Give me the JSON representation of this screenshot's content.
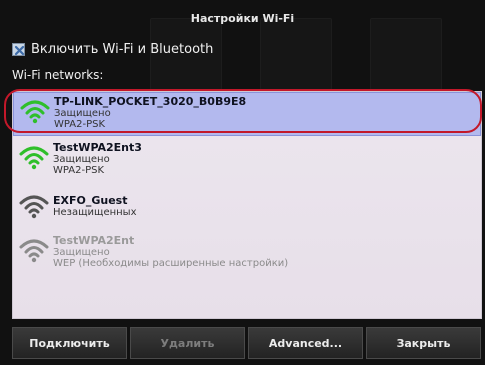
{
  "dialog": {
    "title": "Настройки Wi-Fi"
  },
  "toggle": {
    "label": "Включить Wi-Fi и Bluetooth",
    "checked": false
  },
  "networks_heading": "Wi-Fi networks:",
  "networks": [
    {
      "name": "TP-LINK_POCKET_3020_B0B9E8",
      "status": "Защищено",
      "security": "WPA2-PSK",
      "signal_color": "#2fbf2a",
      "selected": true,
      "disabled": false
    },
    {
      "name": "TestWPA2Ent3",
      "status": "Защищено",
      "security": "WPA2-PSK",
      "signal_color": "#2fbf2a",
      "selected": false,
      "disabled": false
    },
    {
      "name": "EXFO_Guest",
      "status": "Незащищенных",
      "security": "",
      "signal_color": "#555555",
      "selected": false,
      "disabled": false
    },
    {
      "name": "TestWPA2Ent",
      "status": "Защищено",
      "security": "WEP (Необходимы расширенные настройки)",
      "signal_color": "#8a8a8a",
      "selected": false,
      "disabled": true
    }
  ],
  "buttons": {
    "connect": "Подключить",
    "delete": "Удалить",
    "advanced": "Advanced...",
    "close": "Закрыть"
  }
}
